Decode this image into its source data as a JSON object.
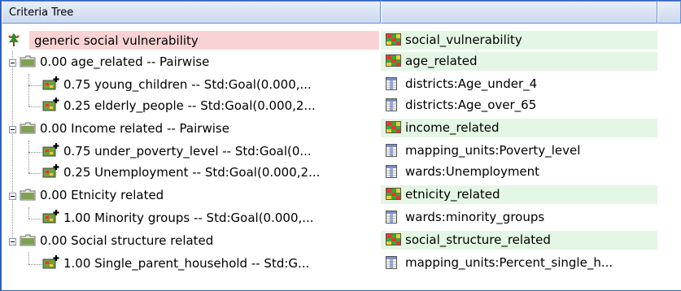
{
  "header": {
    "col1": "Criteria Tree",
    "col2": "",
    "col3": ""
  },
  "rows": [
    {
      "type": "root",
      "label": "generic social vulnerability",
      "map": "social_vulnerability",
      "map_icon": "raster-map-icon"
    },
    {
      "type": "group",
      "label": "0.00 age_related -- Pairwise",
      "map": "age_related",
      "map_icon": "raster-map-icon"
    },
    {
      "type": "leaf",
      "label": "0.75 young_children -- Std:Goal(0.000,...",
      "map": "districts:Age_under_4",
      "map_icon": "table-column-icon"
    },
    {
      "type": "leaf",
      "label": "0.25 elderly_people -- Std:Goal(0.000,2...",
      "map": "districts:Age_over_65",
      "map_icon": "table-column-icon"
    },
    {
      "type": "group",
      "label": "0.00 Income  related -- Pairwise",
      "map": "income_related",
      "map_icon": "raster-map-icon"
    },
    {
      "type": "leaf",
      "label": "0.75 under_poverty_level -- Std:Goal(0...",
      "map": "mapping_units:Poverty_level",
      "map_icon": "table-column-icon"
    },
    {
      "type": "leaf",
      "label": "0.25 Unemployment -- Std:Goal(0.000,2...",
      "map": "wards:Unemployment",
      "map_icon": "table-column-icon"
    },
    {
      "type": "group",
      "label": "0.00 Etnicity related",
      "map": "etnicity_related",
      "map_icon": "raster-map-icon"
    },
    {
      "type": "leaf",
      "label": "1.00 Minority groups -- Std:Goal(0.000,...",
      "map": "wards:minority_groups",
      "map_icon": "table-column-icon"
    },
    {
      "type": "group",
      "label": "0.00 Social structure related",
      "map": "social_structure_related",
      "map_icon": "raster-map-icon"
    },
    {
      "type": "leaf",
      "label": "1.00 Single_parent_household -- Std:G...",
      "map": "mapping_units:Percent_single_h...",
      "map_icon": "table-column-icon"
    }
  ],
  "colors": {
    "root_highlight": "#f9d3d3",
    "map_highlight": "#e4f6e4",
    "header_border": "#6b8fd0"
  }
}
